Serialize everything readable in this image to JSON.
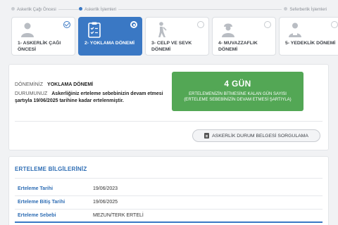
{
  "steps": {
    "left": "Askerlik Çağı Öncesi",
    "middle": "Askerlik İşlemleri",
    "right": "Seferberlik İşlemleri"
  },
  "phases": [
    {
      "title": "1- ASKERLİK ÇAĞI ÖNCESİ",
      "icon": "person-icon",
      "state": "completed"
    },
    {
      "title": "2- YOKLAMA DÖNEMİ",
      "icon": "clipboard-checklist-icon",
      "state": "active"
    },
    {
      "title": "3- CELP VE SEVK DÖNEMİ",
      "icon": "walking-soldier-icon",
      "state": "pending"
    },
    {
      "title": "4- MUVAZZAFLIK DÖNEMİ",
      "icon": "soldier-helmet-icon",
      "state": "pending"
    },
    {
      "title": "5- YEDEKLİK DÖNEMİ",
      "icon": "reserve-person-icon",
      "state": "pending"
    }
  ],
  "status": {
    "period_label": "DÖNEMİNİZ",
    "period_value": "YOKLAMA DÖNEMİ",
    "condition_label": "DURUMUNUZ",
    "condition_value": "Askerliğiniz erteleme sebebinizin devam etmesi şartıyla 19/06/2025 tarihine kadar ertelenmiştir."
  },
  "countdown": {
    "days": "4 GÜN",
    "line1": "ERTELEMENİZİN BİTMESİNE KALAN GÜN SAYISI",
    "line2": "(ERTELEME SEBEBİNİZİN DEVAM ETMESİ ŞARTIYLA)",
    "color": "#53a755"
  },
  "query_button": "ASKERLİK DURUM BELGESİ SORGULAMA",
  "deferral": {
    "title": "ERTELEME BİLGİLERİNİZ",
    "rows": [
      {
        "label": "Erteleme Tarihi",
        "value": "19/06/2023"
      },
      {
        "label": "Erteleme Bitiş Tarihi",
        "value": "19/06/2025"
      },
      {
        "label": "Erteleme Sebebi",
        "value": "MEZUN/TERK ERTELİ"
      }
    ]
  },
  "accent_color": "#3a78c4"
}
